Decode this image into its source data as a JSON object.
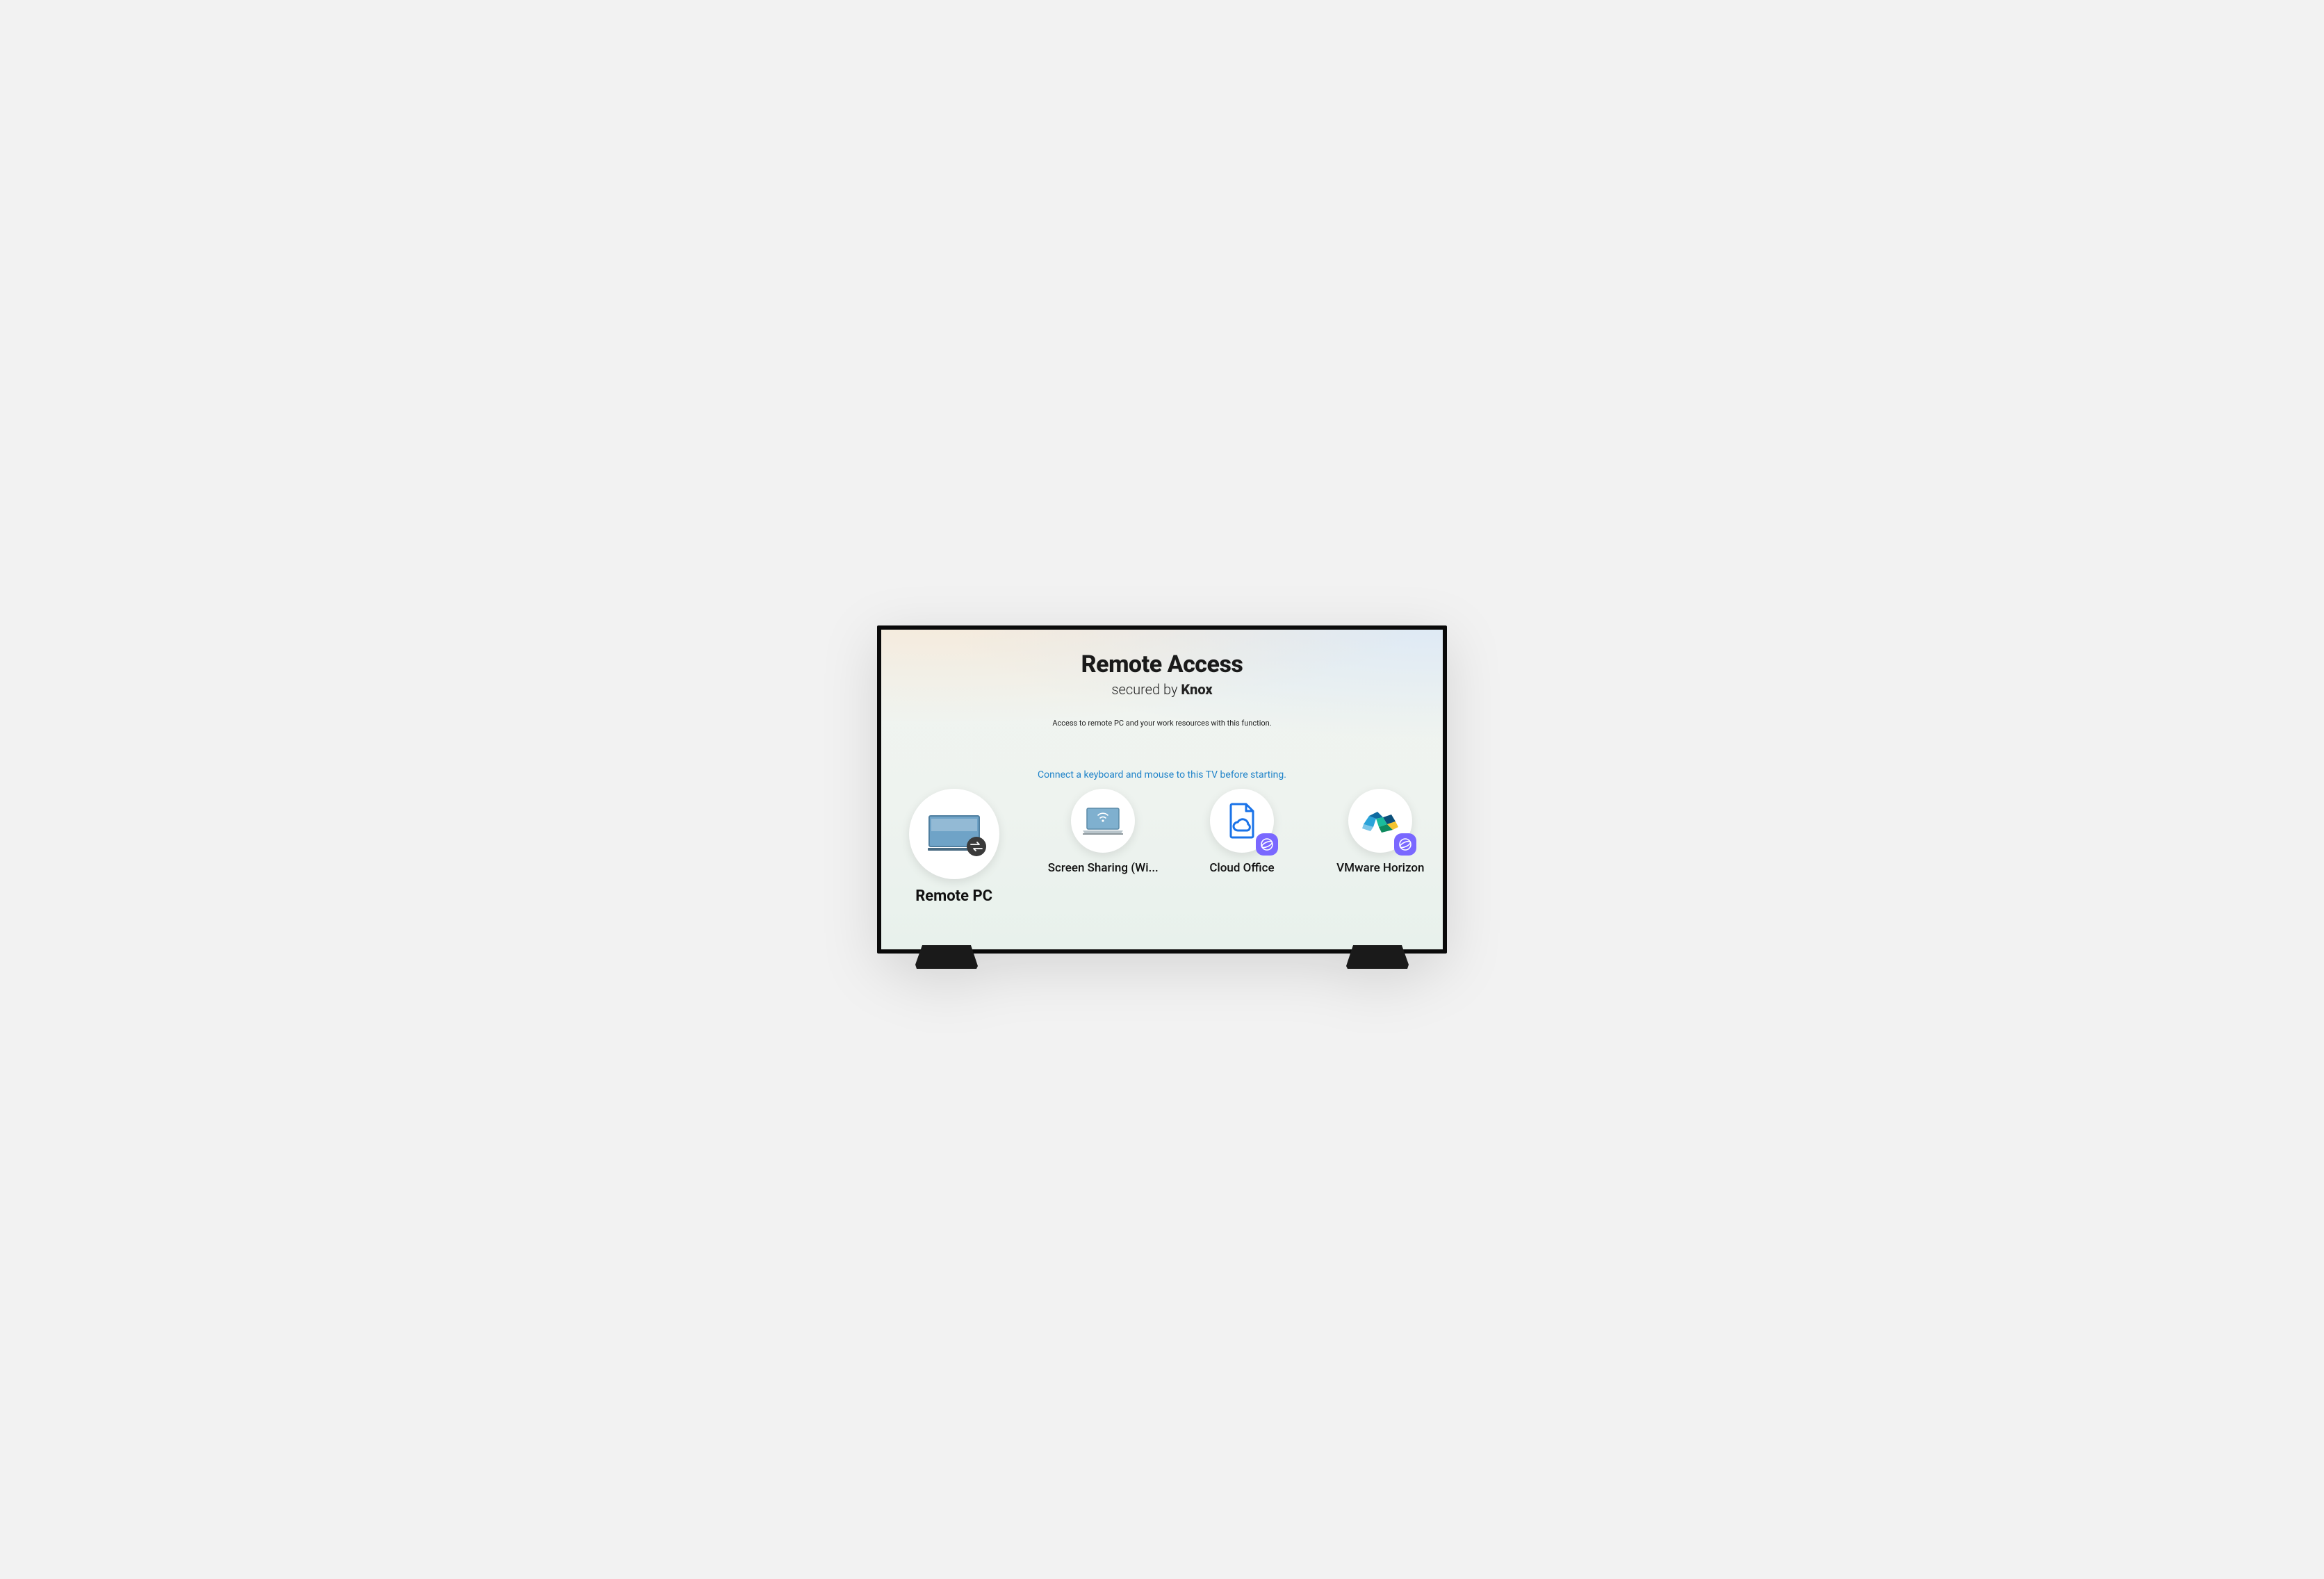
{
  "header": {
    "title": "Remote Access",
    "subtitle_prefix": "secured by ",
    "subtitle_brand": "Knox",
    "description": "Access to remote PC and your work resources with this function.",
    "hint": "Connect a keyboard and mouse to this TV before starting."
  },
  "tiles": {
    "remote_pc": {
      "label": "Remote PC"
    },
    "screen_sharing": {
      "label": "Screen Sharing (Wi..."
    },
    "cloud_office": {
      "label": "Cloud Office"
    },
    "vmware": {
      "label": "VMware Horizon"
    }
  }
}
